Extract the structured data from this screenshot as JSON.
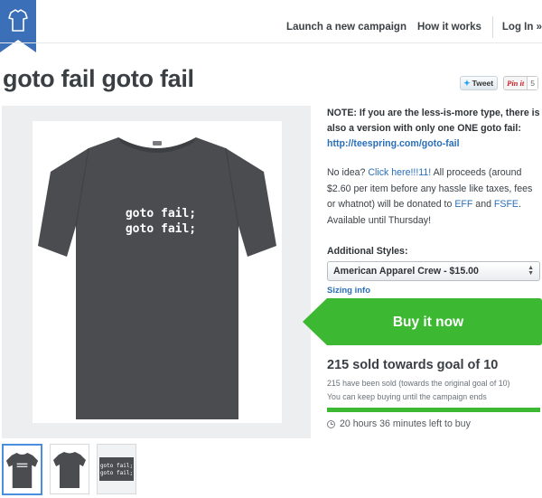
{
  "nav": {
    "launch_label": "Launch a new campaign",
    "how_label": "How it works",
    "login_label": "Log In »"
  },
  "colors": {
    "brand_blue": "#3b6fb7",
    "buy_green": "#3cb832",
    "link_blue": "#2a6fb8",
    "panel_gray": "#eceef0"
  },
  "page_title": "goto fail goto fail",
  "social": {
    "tweet_label": "Tweet",
    "pin_label": "Pin it",
    "pin_count": "5"
  },
  "shirt": {
    "print_line1": "goto fail;",
    "print_line2": "goto fail;"
  },
  "note": {
    "text": "NOTE: If you are the less-is-more type, there is also a version with only one ONE goto fail: ",
    "link": "http://teespring.com/goto-fail"
  },
  "description": {
    "part1": "No idea? ",
    "link1": "Click here!!!11!",
    "part2": " All proceeds (around $2.60 per item before any hassle like taxes, fees or whatnot) will be donated to ",
    "link2": "EFF",
    "part3": " and ",
    "link3": "FSFE",
    "part4": ". Available until Thursday!"
  },
  "styles": {
    "label": "Additional Styles:",
    "selected": "American Apparel Crew - $15.00",
    "sizing_link": "Sizing info"
  },
  "buy": {
    "label": "Buy it now"
  },
  "campaign": {
    "sold_title": "215 sold towards goal of 10",
    "sold_line1": "215 have been sold (towards the original goal of 10)",
    "sold_line2": "You can keep buying until the campaign ends",
    "progress_fraction": 1.0,
    "time_left": "20 hours 36 minutes left to buy"
  },
  "thumbnails": {
    "thumb3_line1": "goto fail;",
    "thumb3_line2": "goto fail;"
  }
}
